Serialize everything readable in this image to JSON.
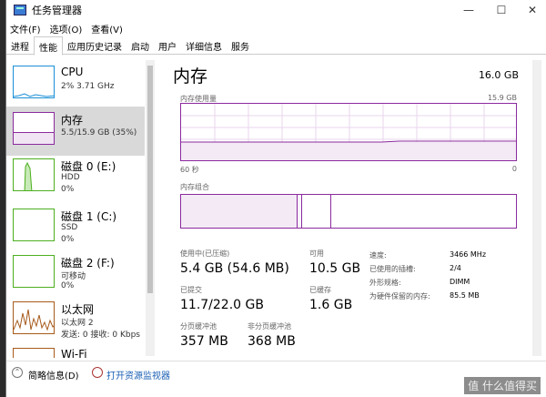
{
  "window": {
    "title": "任务管理器",
    "minimize": "—",
    "maximize": "☐",
    "close": "✕"
  },
  "menu": [
    "文件(F)",
    "选项(O)",
    "查看(V)"
  ],
  "tabs": [
    "进程",
    "性能",
    "应用历史记录",
    "启动",
    "用户",
    "详细信息",
    "服务"
  ],
  "active_tab": 1,
  "sidebar": [
    {
      "name": "CPU",
      "sub1": "2% 3.71 GHz",
      "sub2": "",
      "color": "#1a8fd6"
    },
    {
      "name": "内存",
      "sub1": "5.5/15.9 GB (35%)",
      "sub2": "",
      "color": "#8b2a9e"
    },
    {
      "name": "磁盘 0 (E:)",
      "sub1": "HDD",
      "sub2": "0%",
      "color": "#4caf1e"
    },
    {
      "name": "磁盘 1 (C:)",
      "sub1": "SSD",
      "sub2": "0%",
      "color": "#4caf1e"
    },
    {
      "name": "磁盘 2 (F:)",
      "sub1": "可移动",
      "sub2": "0%",
      "color": "#4caf1e"
    },
    {
      "name": "以太网",
      "sub1": "以太网 2",
      "sub2": "发送: 0 接收: 0 Kbps",
      "color": "#a75a1b"
    },
    {
      "name": "Wi-Fi",
      "sub1": "",
      "sub2": "",
      "color": "#a75a1b"
    }
  ],
  "main": {
    "title": "内存",
    "total": "16.0 GB",
    "usage_label": "内存使用量",
    "usage_max": "15.9 GB",
    "time_left": "60 秒",
    "time_right": "0",
    "composition_label": "内存组合",
    "usage_fraction": 0.35
  },
  "stats": {
    "in_use_label": "使用中(已压缩)",
    "in_use_value": "5.4 GB (54.6 MB)",
    "available_label": "可用",
    "available_value": "10.5 GB",
    "committed_label": "已提交",
    "committed_value": "11.7/22.0 GB",
    "cached_label": "已缓存",
    "cached_value": "1.6 GB",
    "paged_label": "分页缓冲池",
    "paged_value": "357 MB",
    "nonpaged_label": "非分页缓冲池",
    "nonpaged_value": "368 MB"
  },
  "details": [
    {
      "label": "速度:",
      "value": "3466 MHz"
    },
    {
      "label": "已使用的插槽:",
      "value": "2/4"
    },
    {
      "label": "外形规格:",
      "value": "DIMM"
    },
    {
      "label": "为硬件保留的内存:",
      "value": "85.5 MB"
    }
  ],
  "footer": {
    "summary": "简略信息(D)",
    "monitor": "打开资源监视器"
  },
  "watermark": "值 什么值得买"
}
